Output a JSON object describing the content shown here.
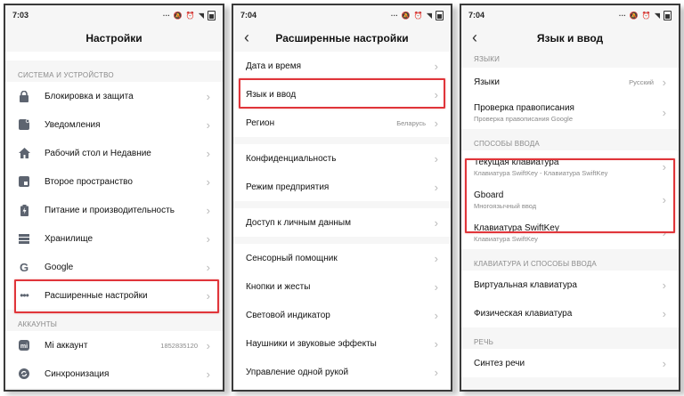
{
  "screen1": {
    "time": "7:03",
    "title": "Настройки",
    "section_system": "СИСТЕМА И УСТРОЙСТВО",
    "items": [
      {
        "label": "Блокировка и защита",
        "icon": "lock-icon"
      },
      {
        "label": "Уведомления",
        "icon": "notifications-icon"
      },
      {
        "label": "Рабочий стол и Недавние",
        "icon": "home-icon"
      },
      {
        "label": "Второе пространство",
        "icon": "second-space-icon"
      },
      {
        "label": "Питание и производительность",
        "icon": "battery-icon"
      },
      {
        "label": "Хранилище",
        "icon": "storage-icon"
      },
      {
        "label": "Google",
        "icon": "google-icon"
      },
      {
        "label": "Расширенные настройки",
        "icon": "more-dots-icon"
      }
    ],
    "section_accounts": "АККАУНТЫ",
    "accounts": [
      {
        "label": "Mi аккаунт",
        "value": "1852835120",
        "icon": "mi-account-icon"
      },
      {
        "label": "Синхронизация",
        "icon": "sync-icon"
      }
    ]
  },
  "screen2": {
    "time": "7:04",
    "title": "Расширенные настройки",
    "items": [
      {
        "label": "Дата и время"
      },
      {
        "label": "Язык и ввод"
      },
      {
        "label": "Регион",
        "value": "Беларусь"
      },
      {
        "label": "Конфиденциальность"
      },
      {
        "label": "Режим предприятия"
      },
      {
        "label": "Доступ к личным данным"
      },
      {
        "label": "Сенсорный помощник"
      },
      {
        "label": "Кнопки и жесты"
      },
      {
        "label": "Световой индикатор"
      },
      {
        "label": "Наушники и звуковые эффекты"
      },
      {
        "label": "Управление одной рукой"
      }
    ]
  },
  "screen3": {
    "time": "7:04",
    "title": "Язык и ввод",
    "section_lang": "ЯЗЫКИ",
    "lang_items": [
      {
        "label": "Языки",
        "value": "Русский"
      },
      {
        "label": "Проверка правописания",
        "sub": "Проверка правописания Google"
      }
    ],
    "section_input": "СПОСОБЫ ВВОДА",
    "input_items": [
      {
        "label": "Текущая клавиатура",
        "sub": "Клавиатура SwiftKey - Клавиатура SwiftKey"
      },
      {
        "label": "Gboard",
        "sub": "Многоязычный ввод"
      },
      {
        "label": "Клавиатура SwiftKey",
        "sub": "Клавиатура SwiftKey"
      }
    ],
    "section_kb": "КЛАВИАТУРА И СПОСОБЫ ВВОДА",
    "kb_items": [
      {
        "label": "Виртуальная клавиатура"
      },
      {
        "label": "Физическая клавиатура"
      }
    ],
    "section_speech": "РЕЧЬ",
    "speech_items": [
      {
        "label": "Синтез речи"
      }
    ]
  },
  "colors": {
    "highlight": "#e0353a",
    "icon": "#5d6470"
  }
}
